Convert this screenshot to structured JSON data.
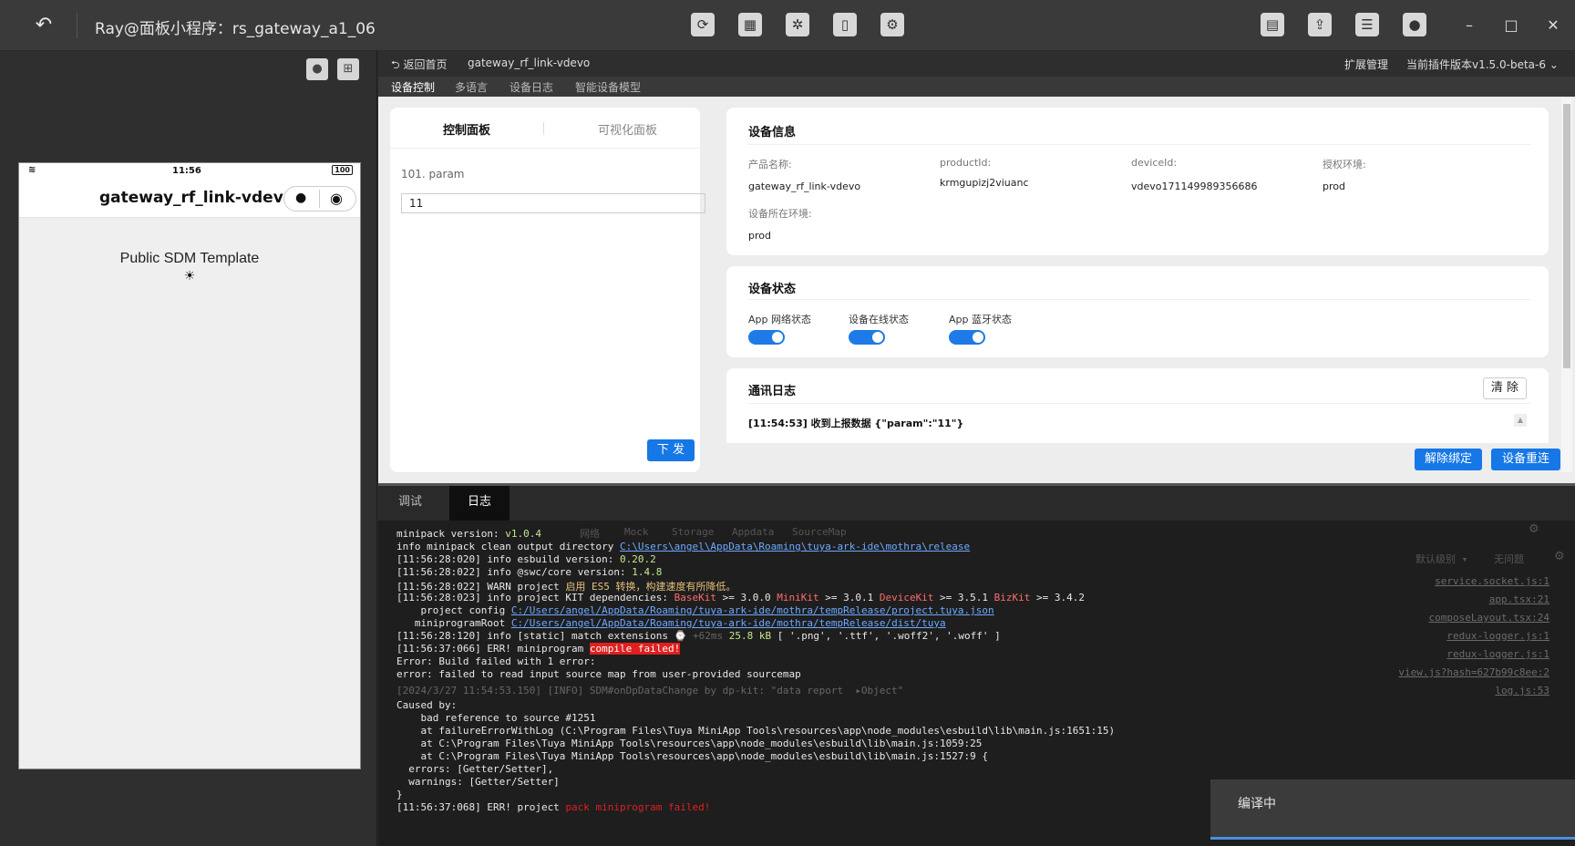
{
  "titlebar": {
    "title": "Ray@面板小程序：rs_gateway_a1_06"
  },
  "phone": {
    "time": "11:56",
    "battery": "100",
    "nav_title": "gateway_rf_link-vdevo",
    "template_text": "Public SDM Template",
    "sun": "☀"
  },
  "breadcrumb": {
    "back": "返回首页",
    "device": "gateway_rf_link-vdevo",
    "ext": "扩展管理",
    "version": "当前插件版本v1.5.0-beta-6"
  },
  "subtabs": [
    "设备控制",
    "多语言",
    "设备日志",
    "智能设备模型"
  ],
  "panel": {
    "tab1": "控制面板",
    "tab2": "可视化面板",
    "param_label": "101. param",
    "param_value": "11",
    "send": "下 发"
  },
  "device_info": {
    "title": "设备信息",
    "product_name_label": "产品名称:",
    "product_name": "gateway_rf_link-vdevo",
    "product_id_label": "productId:",
    "product_id": "krmgupizj2viuanc",
    "device_id_label": "deviceId:",
    "device_id": "vdevo171149989356686",
    "auth_env_label": "授权环境:",
    "auth_env": "prod",
    "device_env_label": "设备所在环境:",
    "device_env": "prod"
  },
  "device_status": {
    "title": "设备状态",
    "net": "App 网络状态",
    "online": "设备在线状态",
    "bt": "App 蓝牙状态"
  },
  "comm_log": {
    "title": "通讯日志",
    "clear": "清 除",
    "entry": "[11:54:53] 收到上报数据 {\"param\":\"11\"}"
  },
  "buttons": {
    "unbind": "解除绑定",
    "reconnect": "设备重连"
  },
  "console": {
    "tab_debug": "调试",
    "tab_log": "日志",
    "ghost_tabs": [
      "网络",
      "Mock",
      "Storage",
      "Appdata",
      "SourceMap"
    ],
    "ghost_filter": "默认级别 ▾",
    "ghost_issues": "无问题",
    "lines": [
      "minipack version: v1.0.4",
      "info minipack clean output directory C:\\Users\\angel\\AppData\\Roaming\\tuya-ark-ide\\mothra\\release",
      "[11:56:28:020] info esbuild version: 0.20.2",
      "[11:56:28:022] info @swc/core version: 1.4.8",
      "[11:56:28:022] WARN project 启用 ES5 转换，构建速度有所降低。",
      "[11:56:28:023] info project KIT dependencies: BaseKit >= 3.0.0 MiniKit >= 3.0.1 DeviceKit >= 3.5.1 BizKit >= 3.4.2",
      "    project config C:/Users/angel/AppData/Roaming/tuya-ark-ide/mothra/tempRelease/project.tuya.json",
      "   miniprogramRoot C:/Users/angel/AppData/Roaming/tuya-ark-ide/mothra/tempRelease/dist/tuya",
      "[11:56:28:120] info [static] match extensions  +62ms 25.8 kB [ '.png', '.ttf', '.woff2', '.woff' ]",
      "[11:56:37:066] ERR! miniprogram compile failed!",
      "Error: Build failed with 1 error:",
      "error: failed to read input source map from user-provided sourcemap",
      "[2024/3/27 11:54:53.150] [INFO] SDM#onDpDataChange by dp-kit: \"data report  ▸Object\"",
      "Caused by:",
      "    bad reference to source #1251",
      "    at failureErrorWithLog (C:\\Program Files\\Tuya MiniApp Tools\\resources\\app\\node_modules\\esbuild\\lib\\main.js:1651:15)",
      "    at C:\\Program Files\\Tuya MiniApp Tools\\resources\\app\\node_modules\\esbuild\\lib\\main.js:1059:25",
      "    at C:\\Program Files\\Tuya MiniApp Tools\\resources\\app\\node_modules\\esbuild\\lib\\main.js:1527:9 {",
      "  errors: [Getter/Setter],",
      "  warnings: [Getter/Setter]",
      "}",
      "[11:56:37:068] ERR! project pack miniprogram failed!"
    ],
    "sources": [
      "service.socket.js:1",
      "app.tsx:21",
      "composeLayout.tsx:24",
      "redux-logger.js:1",
      "redux-logger.js:1",
      "view.js?hash=627b99c8ee:2",
      "log.js:53"
    ]
  },
  "toast": {
    "text": "编译中"
  }
}
